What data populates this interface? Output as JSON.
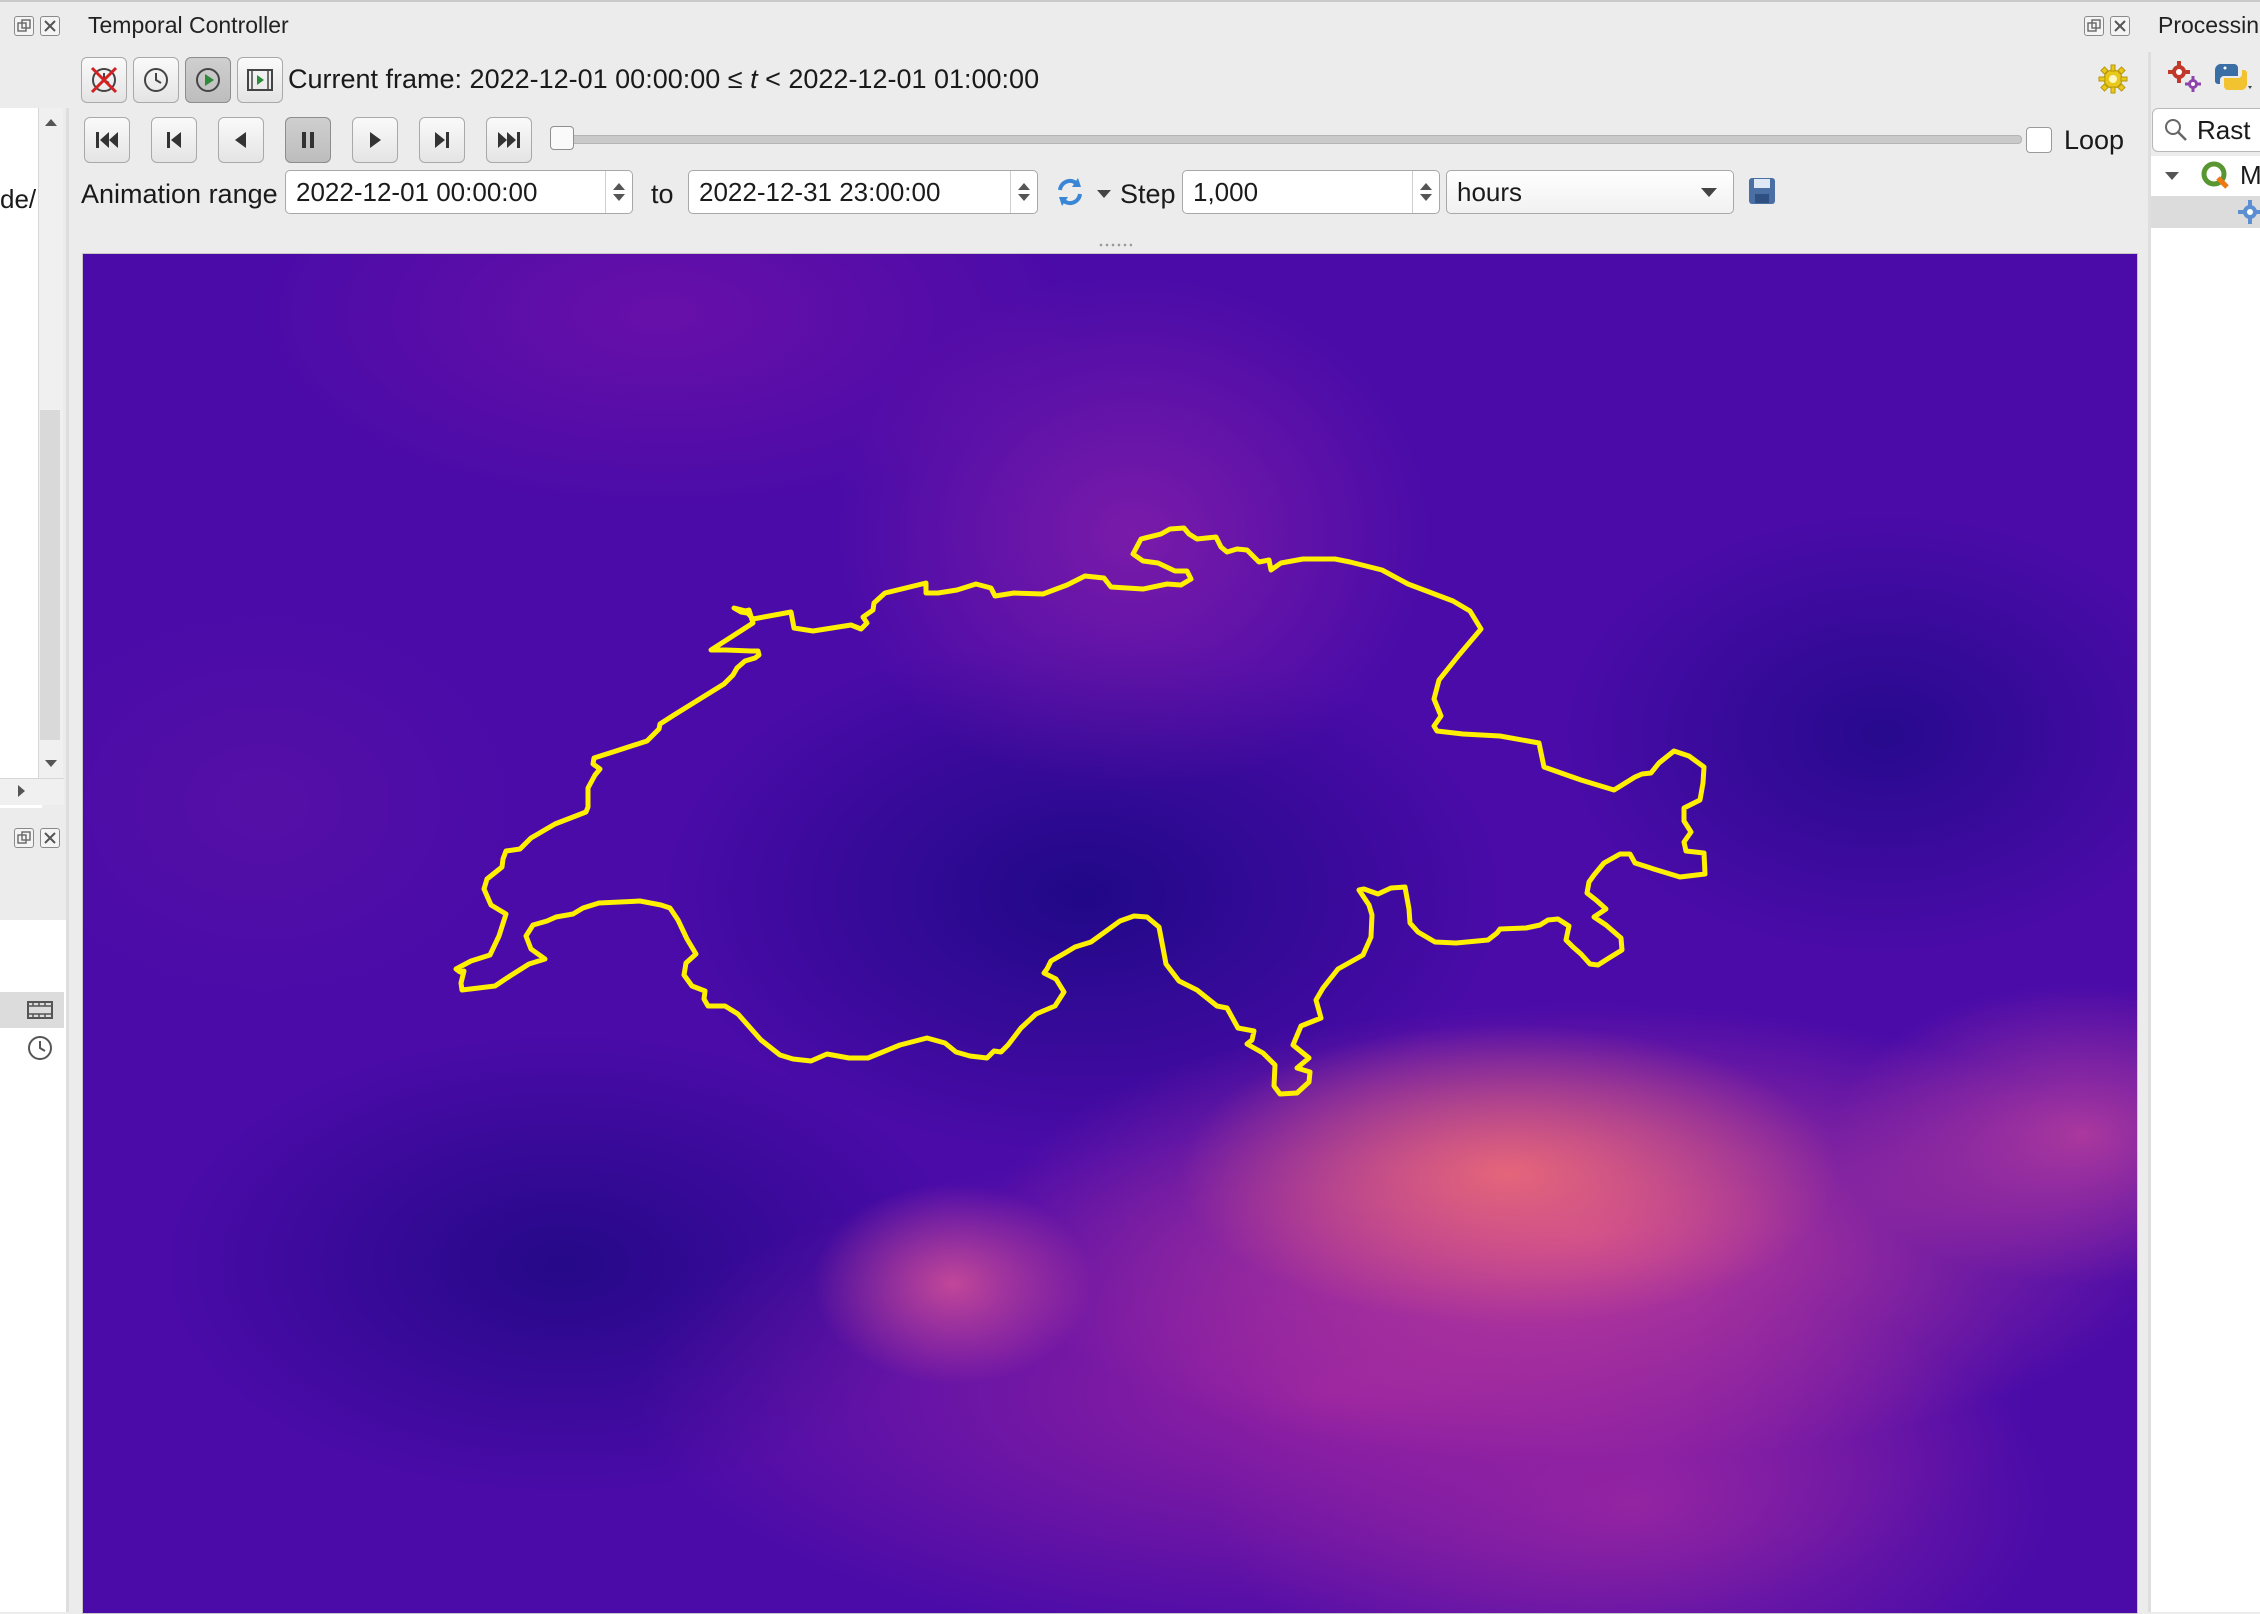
{
  "temporal_panel": {
    "title": "Temporal Controller",
    "current_frame_prefix": "Current frame: 2022-12-01 00:00:00 ≤ ",
    "current_frame_var": "t",
    "current_frame_suffix": " < 2022-12-01 01:00:00",
    "mode_buttons": [
      "disable-temporal-navigation-icon",
      "fixed-range-clock-icon",
      "animated-navigation-play-icon",
      "movie-frames-icon"
    ],
    "playback_buttons": [
      "skip-to-start-icon",
      "step-back-icon",
      "play-backward-icon",
      "pause-icon",
      "play-forward-icon",
      "step-forward-icon",
      "skip-to-end-icon"
    ],
    "frame_slider_position": 0,
    "loop_label": "Loop",
    "loop_checked": false,
    "animation_range_label": "Animation range",
    "range_start": "2022-12-01 00:00:00",
    "to_label": "to",
    "range_end": "2022-12-31 23:00:00",
    "step_label": "Step",
    "step_value": "1,000",
    "step_unit": "hours"
  },
  "right_panel": {
    "title": "Processin",
    "search_text": "Rast",
    "tree_item_label": "M"
  },
  "left_panel": {
    "partial_text": "de/"
  },
  "map": {
    "outline_color": "#ffef00",
    "outline_name": "switzerland-border"
  },
  "colors": {
    "accent_yellow": "#e8c81a",
    "refresh_blue": "#3a86d6",
    "save_blue": "#4a6fa5"
  }
}
